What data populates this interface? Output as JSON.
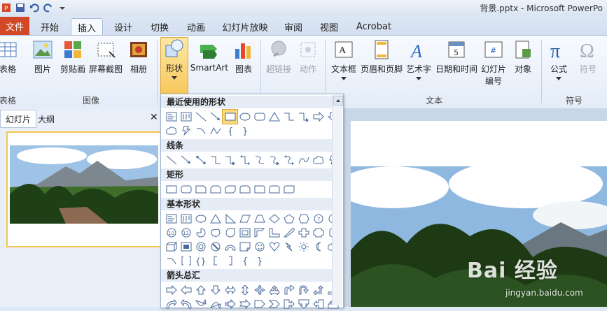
{
  "window": {
    "title": "背景.pptx - Microsoft PowerPo"
  },
  "tabs": {
    "file": "文件",
    "items": [
      "开始",
      "插入",
      "设计",
      "切换",
      "动画",
      "幻灯片放映",
      "审阅",
      "视图",
      "Acrobat"
    ],
    "active": "插入"
  },
  "ribbon": {
    "buttons": {
      "table": "表格",
      "picture": "图片",
      "clipart": "剪贴画",
      "screenshot": "屏幕截图",
      "album": "相册",
      "shapes": "形状",
      "smartart": "SmartArt",
      "chart": "图表",
      "hyperlink": "超链接",
      "action": "动作",
      "textbox": "文本框",
      "header_footer": "页眉和页脚",
      "wordart": "艺术字",
      "datetime": "日期和时间",
      "slide_num_1": "幻灯片",
      "slide_num_2": "编号",
      "object": "对象",
      "equation": "公式",
      "symbol": "符号"
    },
    "groups": {
      "tables": "表格",
      "images": "图像",
      "text": "文本",
      "symbols": "符号"
    }
  },
  "panel": {
    "slides_tab": "幻灯片",
    "outline_tab": "大纲",
    "close": "✕"
  },
  "shapes_menu": {
    "sections": {
      "recent": "最近使用的形状",
      "lines": "线条",
      "rect": "矩形",
      "basic": "基本形状",
      "arrows": "箭头总汇"
    }
  },
  "watermark": {
    "brand": "Bai 经验",
    "url": "jingyan.baidu.com"
  },
  "colors": {
    "file_tab": "#d24726",
    "accent": "#f7c75c"
  }
}
